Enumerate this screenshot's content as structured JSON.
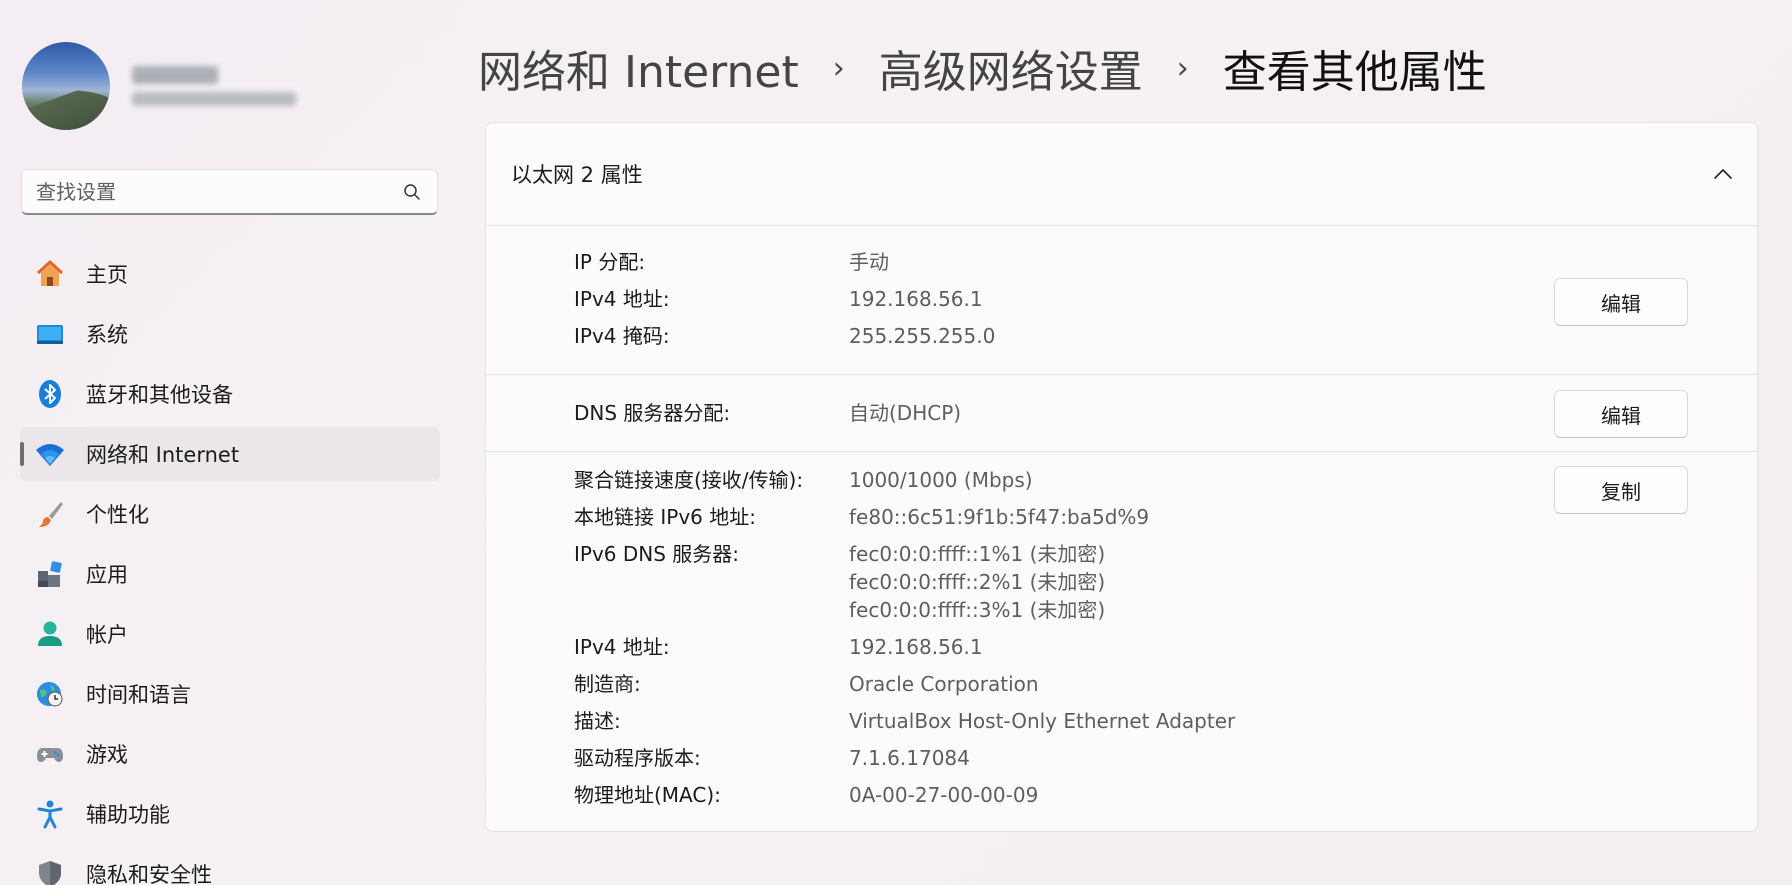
{
  "breadcrumb": {
    "level1": "网络和 Internet",
    "level2": "高级网络设置",
    "current": "查看其他属性",
    "separator": "›"
  },
  "search": {
    "placeholder": "查找设置"
  },
  "sidebar": {
    "items": [
      {
        "label": "主页",
        "icon": "home-icon"
      },
      {
        "label": "系统",
        "icon": "system-display-icon"
      },
      {
        "label": "蓝牙和其他设备",
        "icon": "bluetooth-icon"
      },
      {
        "label": "网络和 Internet",
        "icon": "wifi-icon",
        "active": true
      },
      {
        "label": "个性化",
        "icon": "paintbrush-icon"
      },
      {
        "label": "应用",
        "icon": "apps-icon"
      },
      {
        "label": "帐户",
        "icon": "account-icon"
      },
      {
        "label": "时间和语言",
        "icon": "globe-clock-icon"
      },
      {
        "label": "游戏",
        "icon": "gamepad-icon"
      },
      {
        "label": "辅助功能",
        "icon": "accessibility-icon"
      },
      {
        "label": "隐私和安全性",
        "icon": "shield-icon"
      }
    ]
  },
  "panel": {
    "title": "以太网 2 属性",
    "ip_section": {
      "rows": [
        {
          "key": "IP 分配:",
          "value": "手动"
        },
        {
          "key": "IPv4 地址:",
          "value": "192.168.56.1"
        },
        {
          "key": "IPv4 掩码:",
          "value": "255.255.255.0"
        }
      ],
      "button": "编辑"
    },
    "dns_section": {
      "rows": [
        {
          "key": "DNS 服务器分配:",
          "value": "自动(DHCP)"
        }
      ],
      "button": "编辑"
    },
    "details_section": {
      "button": "复制",
      "rows": [
        {
          "key": "聚合链接速度(接收/传输):",
          "value": "1000/1000 (Mbps)"
        },
        {
          "key": "本地链接 IPv6 地址:",
          "value": "fe80::6c51:9f1b:5f47:ba5d%9"
        },
        {
          "key": "IPv6 DNS 服务器:",
          "value": "fec0:0:0:ffff::1%1 (未加密)",
          "value2": "fec0:0:0:ffff::2%1 (未加密)",
          "value3": "fec0:0:0:ffff::3%1 (未加密)"
        },
        {
          "key": "IPv4 地址:",
          "value": "192.168.56.1"
        },
        {
          "key": "制造商:",
          "value": "Oracle Corporation"
        },
        {
          "key": "描述:",
          "value": "VirtualBox Host-Only Ethernet Adapter"
        },
        {
          "key": "驱动程序版本:",
          "value": "7.1.6.17084"
        },
        {
          "key": "物理地址(MAC):",
          "value": "0A-00-27-00-00-09"
        }
      ]
    }
  }
}
